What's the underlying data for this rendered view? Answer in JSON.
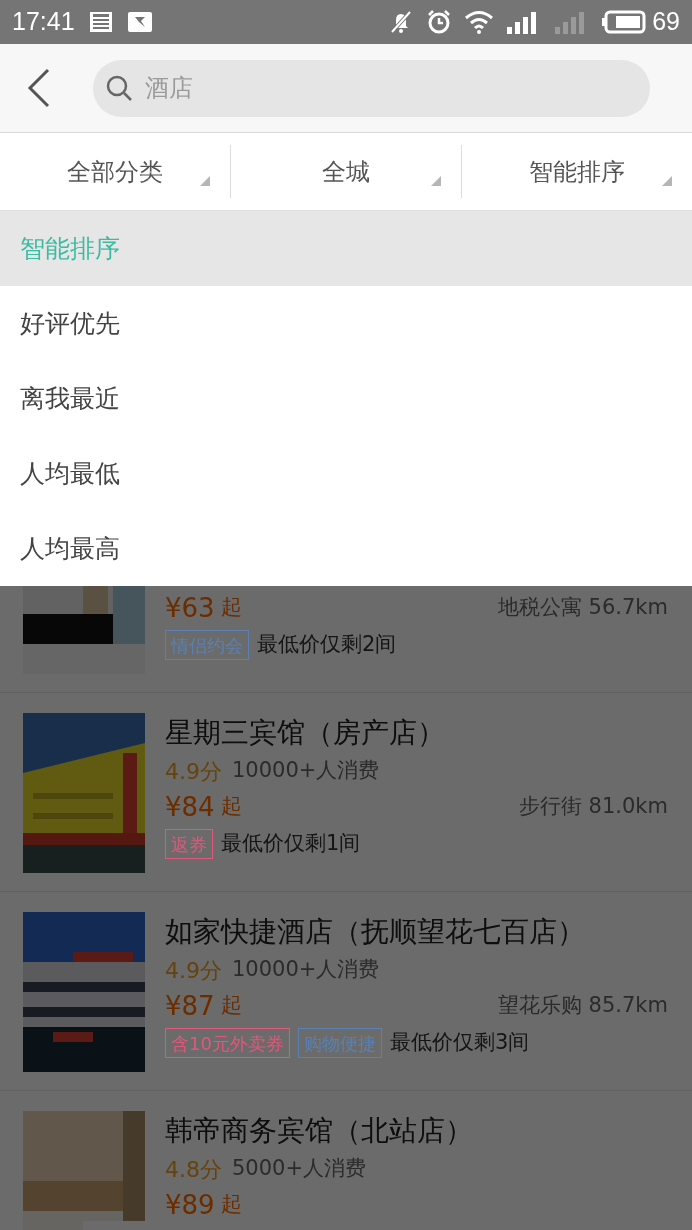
{
  "status_bar": {
    "time": "17:41",
    "battery": "69"
  },
  "search": {
    "placeholder": "酒店"
  },
  "filters": [
    {
      "label": "全部分类"
    },
    {
      "label": "全城"
    },
    {
      "label": "智能排序"
    }
  ],
  "sort_menu": [
    {
      "label": "智能排序",
      "selected": true
    },
    {
      "label": "好评优先",
      "selected": false
    },
    {
      "label": "离我最近",
      "selected": false
    },
    {
      "label": "人均最低",
      "selected": false
    },
    {
      "label": "人均最高",
      "selected": false
    }
  ],
  "hotels": [
    {
      "price": "¥63",
      "price_suffix": "起",
      "distance": "地税公寓 56.7km",
      "tags": [
        {
          "text": "情侣约会",
          "color": "#5a80b4"
        }
      ],
      "note": "最低价仅剩2间"
    },
    {
      "name": "星期三宾馆（房产店）",
      "score": "4.9分",
      "sales": "10000+人消费",
      "price": "¥84",
      "price_suffix": "起",
      "distance": "步行街 81.0km",
      "tags": [
        {
          "text": "返券",
          "color": "#e0587a"
        }
      ],
      "note": "最低价仅剩1间"
    },
    {
      "name": "如家快捷酒店（抚顺望花七百店）",
      "score": "4.9分",
      "sales": "10000+人消费",
      "price": "¥87",
      "price_suffix": "起",
      "distance": "望花乐购 85.7km",
      "tags": [
        {
          "text": "含10元外卖券",
          "color": "#e0587a"
        },
        {
          "text": "购物便捷",
          "color": "#5a80b4"
        }
      ],
      "note": "最低价仅剩3间"
    },
    {
      "name": "韩帝商务宾馆（北站店）",
      "score": "4.8分",
      "sales": "5000+人消费",
      "price": "¥89",
      "price_suffix": "起"
    }
  ]
}
